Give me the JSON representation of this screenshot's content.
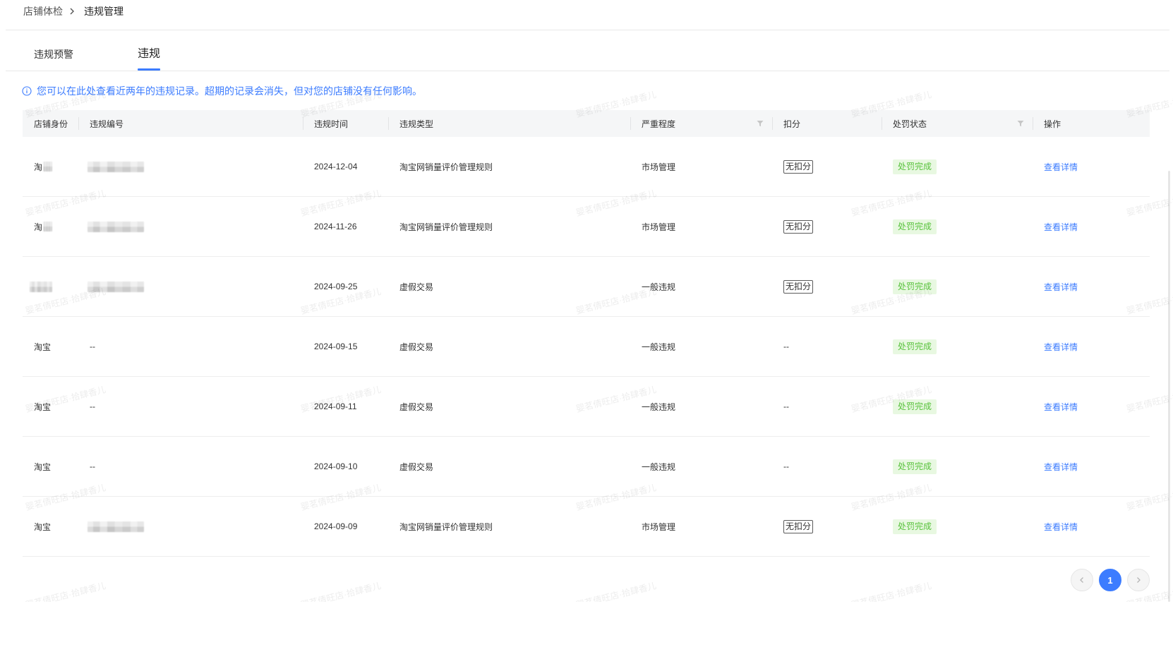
{
  "breadcrumb": {
    "items": [
      "店铺体检",
      "违规管理"
    ],
    "separator_icon": "chevron-right-icon"
  },
  "tabs": [
    {
      "label": "违规预警",
      "active": false
    },
    {
      "label": "违规",
      "active": true
    }
  ],
  "notice": {
    "icon": "info-icon",
    "text": "您可以在此处查看近两年的违规记录。超期的记录会消失，但对您的店铺没有任何影响。"
  },
  "table": {
    "columns": [
      {
        "label": "店铺身份"
      },
      {
        "label": "违规编号"
      },
      {
        "label": "违规时间"
      },
      {
        "label": "违规类型"
      },
      {
        "label": "严重程度",
        "filter": true,
        "filter_icon": "filter-icon"
      },
      {
        "label": "扣分"
      },
      {
        "label": "处罚状态",
        "filter": true,
        "filter_icon": "filter-icon"
      },
      {
        "label": "操作"
      }
    ],
    "rows": [
      {
        "shop": "淘",
        "shop_masked": true,
        "id_masked": true,
        "date": "2024-12-04",
        "type": "淘宝网销量评价管理规则",
        "severity": "市场管理",
        "deduction": "无扣分",
        "deduction_badge": true,
        "status": "处罚完成",
        "action": "查看详情"
      },
      {
        "shop": "淘",
        "shop_masked": true,
        "id_masked": true,
        "date": "2024-11-26",
        "type": "淘宝网销量评价管理规则",
        "severity": "市场管理",
        "deduction": "无扣分",
        "deduction_badge": true,
        "status": "处罚完成",
        "action": "查看详情"
      },
      {
        "shop_masked": true,
        "id_masked": true,
        "date": "2024-09-25",
        "type": "虚假交易",
        "severity": "一般违规",
        "deduction": "无扣分",
        "deduction_badge": true,
        "status": "处罚完成",
        "action": "查看详情"
      },
      {
        "shop": "淘宝",
        "id": "--",
        "date": "2024-09-15",
        "type": "虚假交易",
        "severity": "一般违规",
        "deduction": "--",
        "status": "处罚完成",
        "action": "查看详情"
      },
      {
        "shop": "淘宝",
        "id": "--",
        "date": "2024-09-11",
        "type": "虚假交易",
        "severity": "一般违规",
        "deduction": "--",
        "status": "处罚完成",
        "action": "查看详情"
      },
      {
        "shop": "淘宝",
        "id": "--",
        "date": "2024-09-10",
        "type": "虚假交易",
        "severity": "一般违规",
        "deduction": "--",
        "status": "处罚完成",
        "action": "查看详情"
      },
      {
        "shop": "淘宝",
        "id_masked": true,
        "date": "2024-09-09",
        "type": "淘宝网销量评价管理规则",
        "severity": "市场管理",
        "deduction": "无扣分",
        "deduction_badge": true,
        "status": "处罚完成",
        "action": "查看详情"
      }
    ]
  },
  "pagination": {
    "current": "1",
    "prev_icon": "chevron-left-icon",
    "next_icon": "chevron-right-icon"
  },
  "watermark": {
    "text": "婴茗倩旺店·拾肆香儿"
  },
  "colors": {
    "accent": "#3c7cff",
    "success_bg": "#e8f8e1",
    "success_text": "#58c23c",
    "header_bg": "#f5f6f7",
    "text": "#333333",
    "border": "#eeeeee",
    "watermark": "rgba(0,0,0,0.075)"
  }
}
